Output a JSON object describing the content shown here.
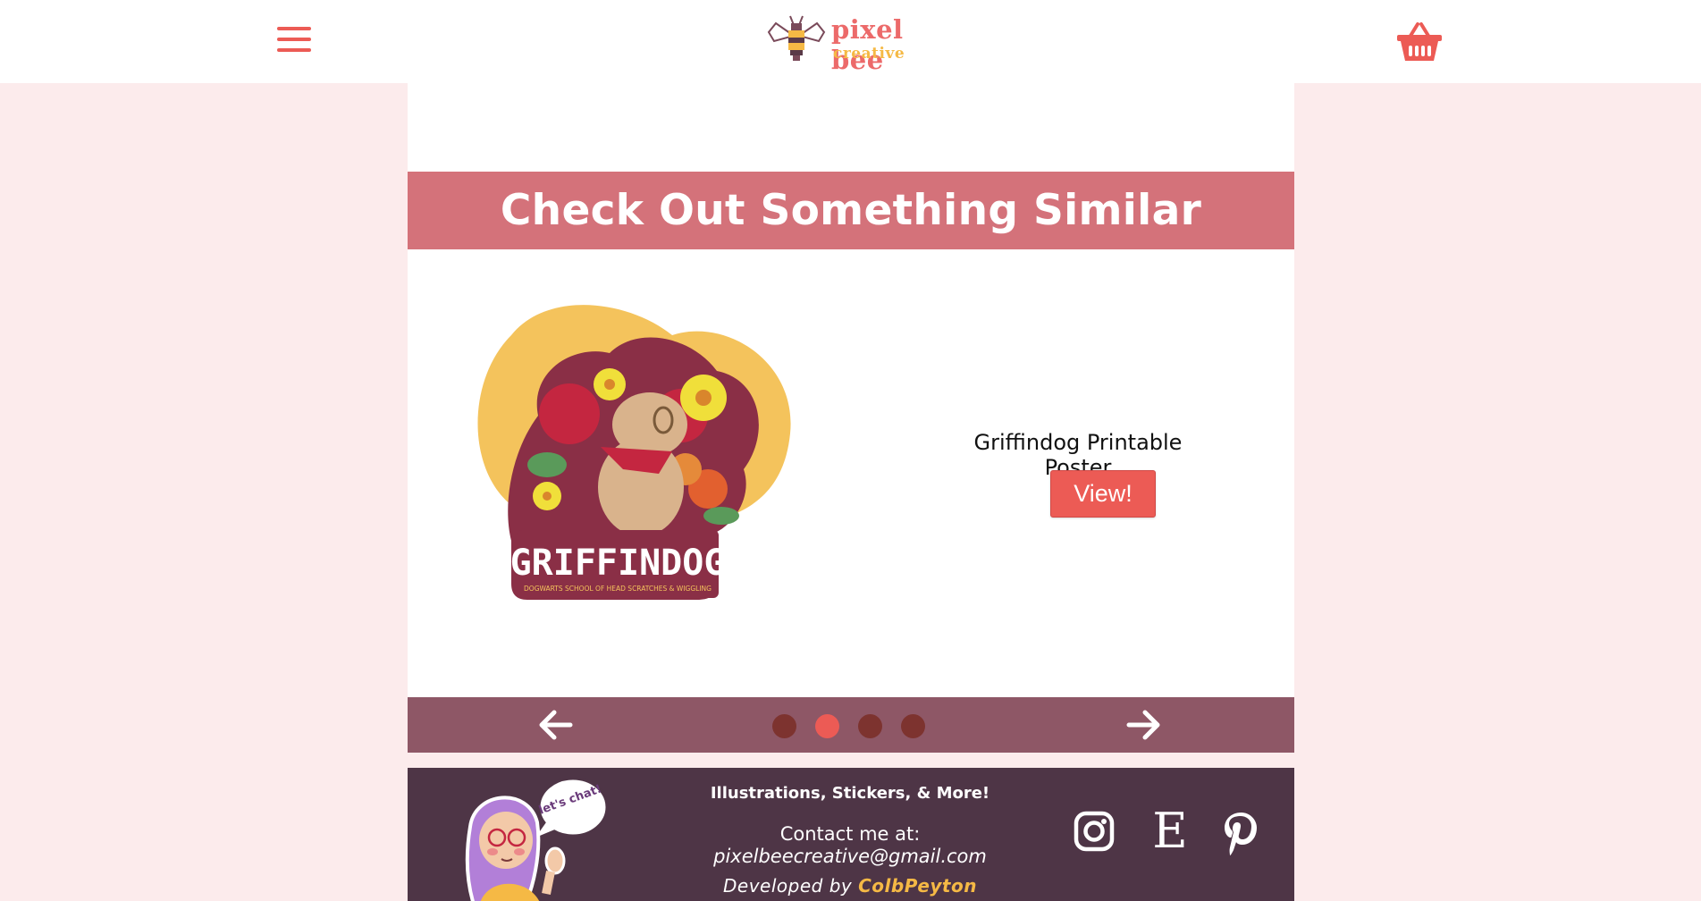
{
  "header": {
    "menu_icon": "hamburger-menu-icon",
    "logo": {
      "main": "pixel bee",
      "sub": "creative"
    },
    "cart_icon": "shopping-basket-icon",
    "colors": {
      "accent": "#ec5b55",
      "logo_pink": "#ec6a6a",
      "logo_yellow": "#f5b945"
    }
  },
  "similar": {
    "heading": "Check Out Something Similar",
    "product": {
      "title": "Griffindog Printable Poster",
      "image_text": "GRIFFINDOG",
      "image_subtext": "DOGWARTS SCHOOL OF HEAD SCRATCHES & WIGGLING",
      "button_label": "View!"
    },
    "carousel": {
      "prev_icon": "arrow-left-icon",
      "next_icon": "arrow-right-icon",
      "dots": 4,
      "active_index": 1
    },
    "colors": {
      "banner": "#d4727a",
      "nav_bar": "#8e5766",
      "dot": "#7d332f",
      "dot_active": "#ec5b55"
    }
  },
  "footer": {
    "avatar_bubble": "let's chat!",
    "tagline": "Illustrations, Stickers, & More!",
    "contact_label": "Contact me at:",
    "contact_email": "pixelbeecreative@gmail.com",
    "developed_prefix": "Developed by",
    "developer": "ColbPeyton",
    "social": [
      {
        "name": "instagram-icon"
      },
      {
        "name": "etsy-icon",
        "glyph": "E"
      },
      {
        "name": "pinterest-icon"
      }
    ],
    "colors": {
      "background": "#4e3546",
      "highlight": "#f5b945"
    }
  }
}
